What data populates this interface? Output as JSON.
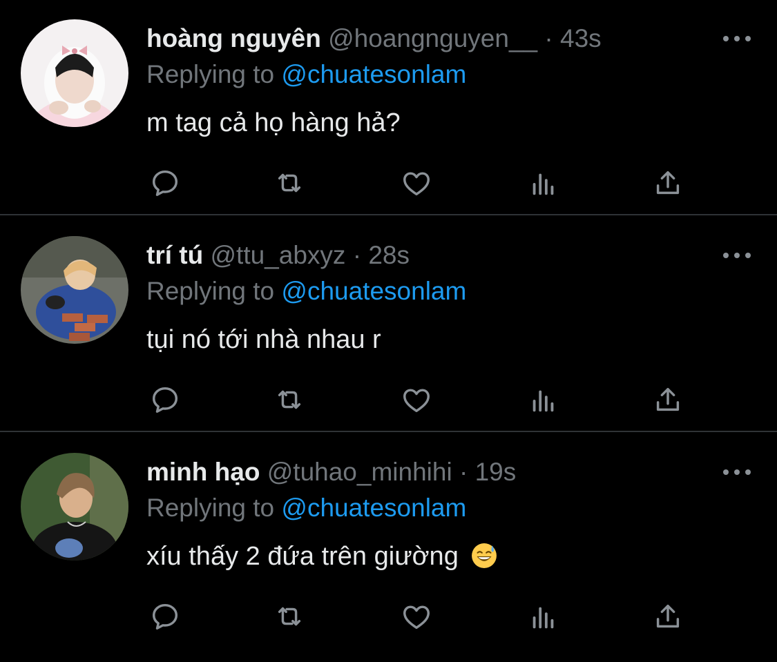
{
  "colors": {
    "background": "#000000",
    "primary_text": "#e7e9ea",
    "secondary_text": "#71767b",
    "link": "#1d9bf0",
    "divider": "#2f3336"
  },
  "tweets": [
    {
      "name": "hoàng nguyên",
      "handle": "@hoangnguyen__",
      "separator": "·",
      "time": "43s",
      "replying_label": "Replying to",
      "replying_to": "@chuatesonlam",
      "text": "m tag cả họ hàng hả?",
      "avatar_icon": "avatar-photo"
    },
    {
      "name": "trí tú",
      "handle": "@ttu_abxyz",
      "separator": "·",
      "time": "28s",
      "replying_label": "Replying to",
      "replying_to": "@chuatesonlam",
      "text": "tụi nó tới nhà nhau r",
      "avatar_icon": "avatar-photo"
    },
    {
      "name": "minh hạo",
      "handle": "@tuhao_minhihi",
      "separator": "·",
      "time": "19s",
      "replying_label": "Replying to",
      "replying_to": "@chuatesonlam",
      "text": "xíu thấy 2 đứa trên giường",
      "emoji": "grinning-face-with-sweat",
      "avatar_icon": "avatar-photo"
    }
  ],
  "action_icons": [
    "reply-icon",
    "retweet-icon",
    "like-icon",
    "analytics-icon",
    "share-icon"
  ],
  "more_icon": "more-options-icon"
}
